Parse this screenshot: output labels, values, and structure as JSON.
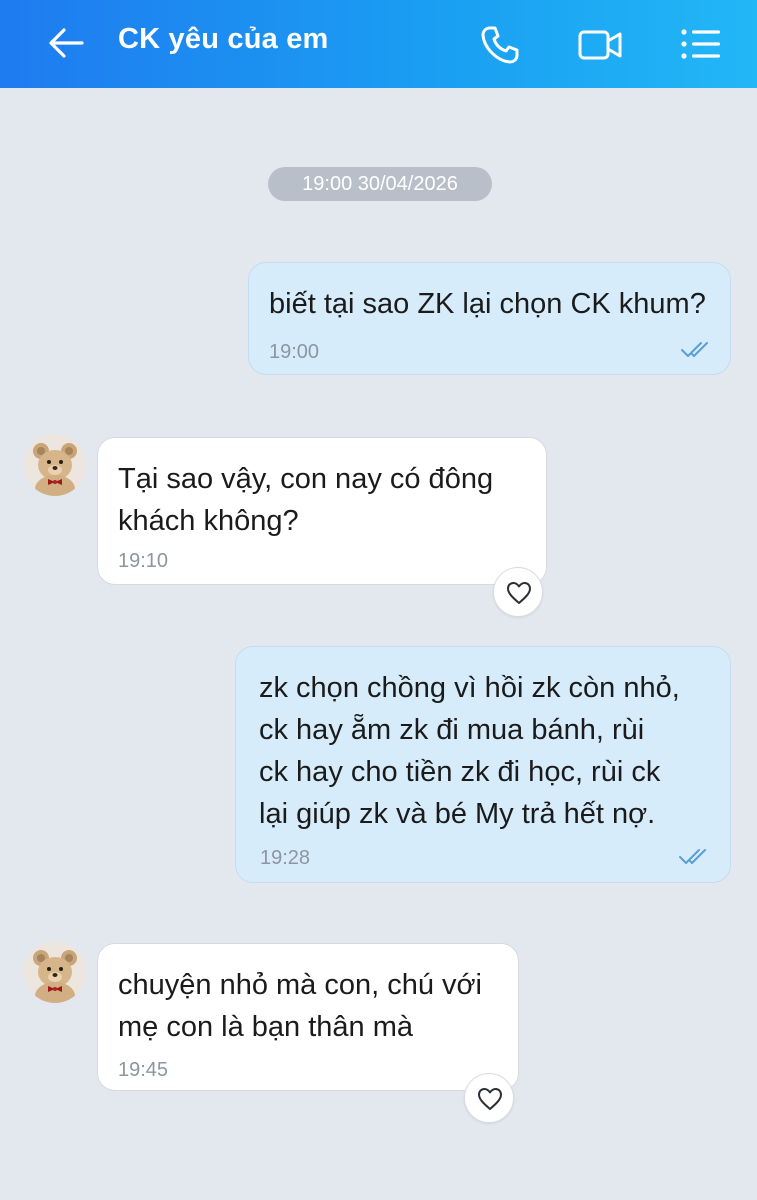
{
  "header": {
    "title": "CK yêu của em",
    "back_icon": "back-arrow-icon",
    "call_icon": "phone-icon",
    "video_icon": "video-camera-icon",
    "menu_icon": "menu-list-icon",
    "background": "#1f8ff2"
  },
  "date_separator": "19:00 30/04/2026",
  "messages": [
    {
      "direction": "outgoing",
      "text": "biết tại sao ZK lại chọn CK khum?",
      "time": "19:00",
      "status": "double-check-icon"
    },
    {
      "direction": "incoming",
      "text": "Tại sao vậy, con nay có đông\nkhách không?",
      "time": "19:10",
      "reaction_icon": "heart-icon"
    },
    {
      "direction": "outgoing",
      "text": "zk chọn chồng vì hồi zk còn nhỏ,\nck hay ẵm zk đi mua bánh, rùi\nck hay cho tiền zk đi học, rùi ck\nlại giúp zk và bé My trả hết nợ.",
      "time": "19:28",
      "status": "double-check-icon"
    },
    {
      "direction": "incoming",
      "text": "chuyện nhỏ mà con, chú với\nmẹ con là bạn thân mà",
      "time": "19:45",
      "reaction_icon": "heart-icon"
    }
  ],
  "colors": {
    "chat_background": "#e3e8ef",
    "outgoing_bubble": "#d7ecfb",
    "incoming_bubble": "#ffffff"
  }
}
